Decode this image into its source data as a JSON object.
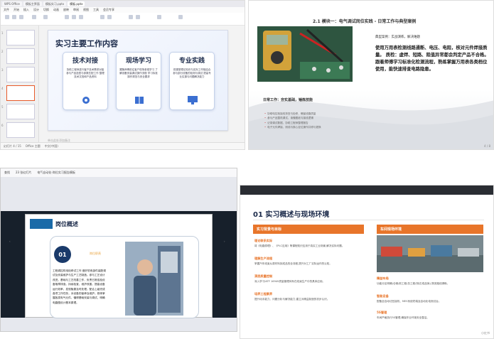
{
  "q1": {
    "tabs": [
      "WPS Office",
      "模板主界面",
      "模板实习.pptx",
      "模板.pptx"
    ],
    "menus": [
      "文件",
      "开始",
      "插入",
      "设计",
      "切换",
      "动画",
      "放映",
      "审阅",
      "视图",
      "工具",
      "会员专享"
    ],
    "thumb_numbers": [
      "1",
      "2",
      "3",
      "4",
      "5",
      "6"
    ],
    "slide_title": "实习主要工作内容",
    "cards": [
      {
        "title": "技术对接",
        "desc": "协助工程师进行客户技术需求对接 参与产品选型与参数匹配工作 整理技术文档和产品资料"
      },
      {
        "title": "现场学习",
        "desc": "跟随师傅前往客户现场参观学习 了解设备安装调试操作流程 学习标准操作规范与安全要求"
      },
      {
        "title": "专业实践",
        "desc": "将课堂理论知识与实际工作相结合 参与部分设备的检测与调试 提高专业实操与问题解决能力"
      }
    ],
    "note": "单击此处添加备注",
    "status": [
      "幻灯片 4 / 15",
      "Office 主题",
      "中文(中国)"
    ]
  },
  "q2": {
    "title": "2.1 模块一：电气调试岗位实践 - 日常工作与典型案例",
    "case_heading": "典型案例：实战演练，解决难题",
    "case_text": "使用万用表检测线路通断、电压、电阻，核对元件焊接质量。 质检：虚焊、短路、阻值异常都会判定产品不合格。跟着师傅学习标准化检测流程，熟练掌握万用表各类档位使用，能快速排查电路隐患。",
    "sub_heading": "日常工作：夯实基础，锤炼技能",
    "bullets": [
      "协助电控柜接线排查与检修，确保线路质量",
      "参与产品整机调试，读懂图纸与接线逻辑",
      "记录调试数据，协助工程师整理报告",
      "电子元件焊接、测线与核心定位操作并修与更换"
    ],
    "pager": "4 / 8"
  },
  "q3": {
    "topbar": [
      "查找",
      "23 张幻灯片",
      "电气自动化-岗位实习报告模板"
    ],
    "title": "岗位概述",
    "number": "01",
    "role": "岗位职责",
    "text": "工程调控机电检修试工作 做好机电部件装配调试及安装维护与生产工艺制造。参与工艺设计改进，基础与工艺改善工作，负责日常巡检设备故障排查。持续检查，维护改善，提高设备运行效率，发现隐患及时处理。配合上级完成各项工作任务，对设备的保养及维护。熟练掌握各类电气元件，懂得基础安装与调试，明确电路图设计基本原理。"
  },
  "q4": {
    "title": "01 实习概述与现场环境",
    "left_header": "实习背景与目标",
    "right_header": "车间现场环境",
    "left_items": [
      {
        "h": "理论联系实际",
        "t": "将《电路原理》、《PLC应用》等课程知识应用于真实工业场景,解决实际问题。"
      },
      {
        "h": "理解生产流程",
        "t": "掌握汽车线束从原材料到成品的全流程,提升对工厂实际运作的认知。"
      },
      {
        "h": "洞悉质量控制",
        "t": "深入学习IATF 16949质量管理体系在线束生产中的具体应用。"
      },
      {
        "h": "培养工程素养",
        "t": "提升动手能力、问题分析与解决能力,建立对精益制造的初步认识。"
      }
    ],
    "right_items": [
      {
        "h": "精益布局",
        "t": "功能分区明确(仓储/前工程/总工程/测试/成品库),物流路线清晰。"
      },
      {
        "h": "智能设备",
        "t": "配备全自动切压接机、MES系统终端及自动化电测试台。"
      },
      {
        "h": "5S管理",
        "t": "车间严格执行5S管理,确保作业环境安全整洁。"
      }
    ],
    "watermark": "小红书"
  }
}
